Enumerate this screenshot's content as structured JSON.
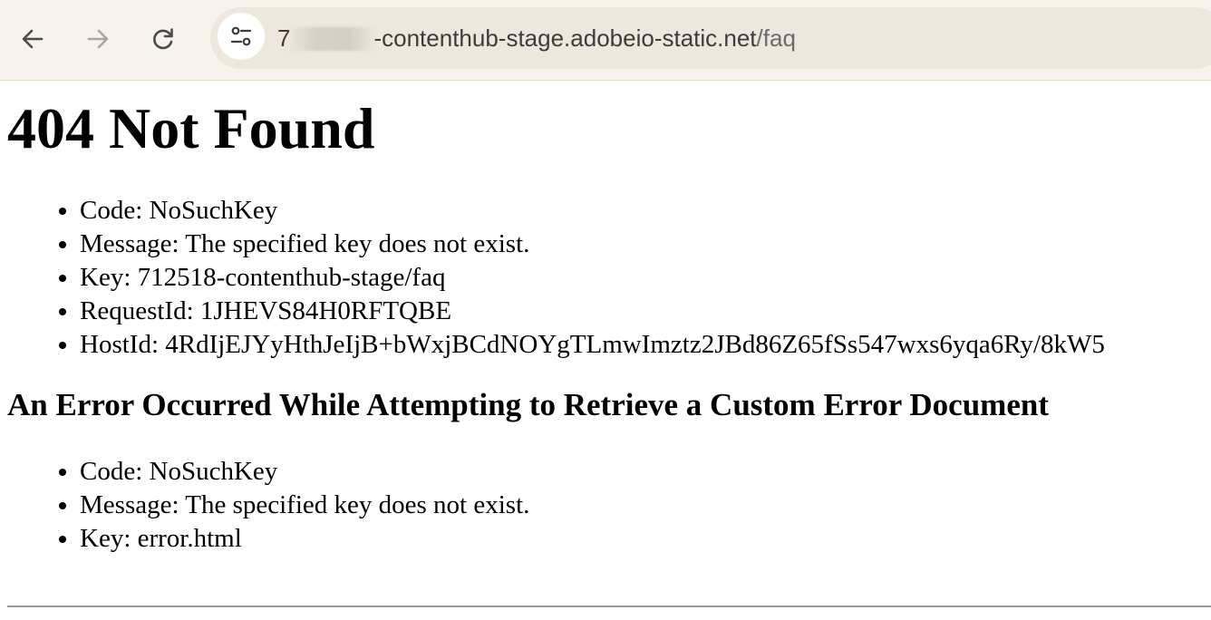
{
  "browser": {
    "url_prefix": "7",
    "url_host": "-contenthub-stage.adobeio-static.net",
    "url_path": "/faq",
    "icons": {
      "back": "arrow-left-icon",
      "forward": "arrow-right-icon",
      "reload": "reload-icon",
      "site_info": "tune-icon"
    }
  },
  "page": {
    "title": "404 Not Found",
    "details": [
      "Code: NoSuchKey",
      "Message: The specified key does not exist.",
      "Key: 712518-contenthub-stage/faq",
      "RequestId: 1JHEVS84H0RFTQBE",
      "HostId: 4RdIjEJYyHthJeIjB+bWxjBCdNOYgTLmwImztz2JBd86Z65fSs547wxs6yqa6Ry/8kW5"
    ],
    "error_heading": "An Error Occurred While Attempting to Retrieve a Custom Error Document",
    "error_details": [
      "Code: NoSuchKey",
      "Message: The specified key does not exist.",
      "Key: error.html"
    ]
  }
}
